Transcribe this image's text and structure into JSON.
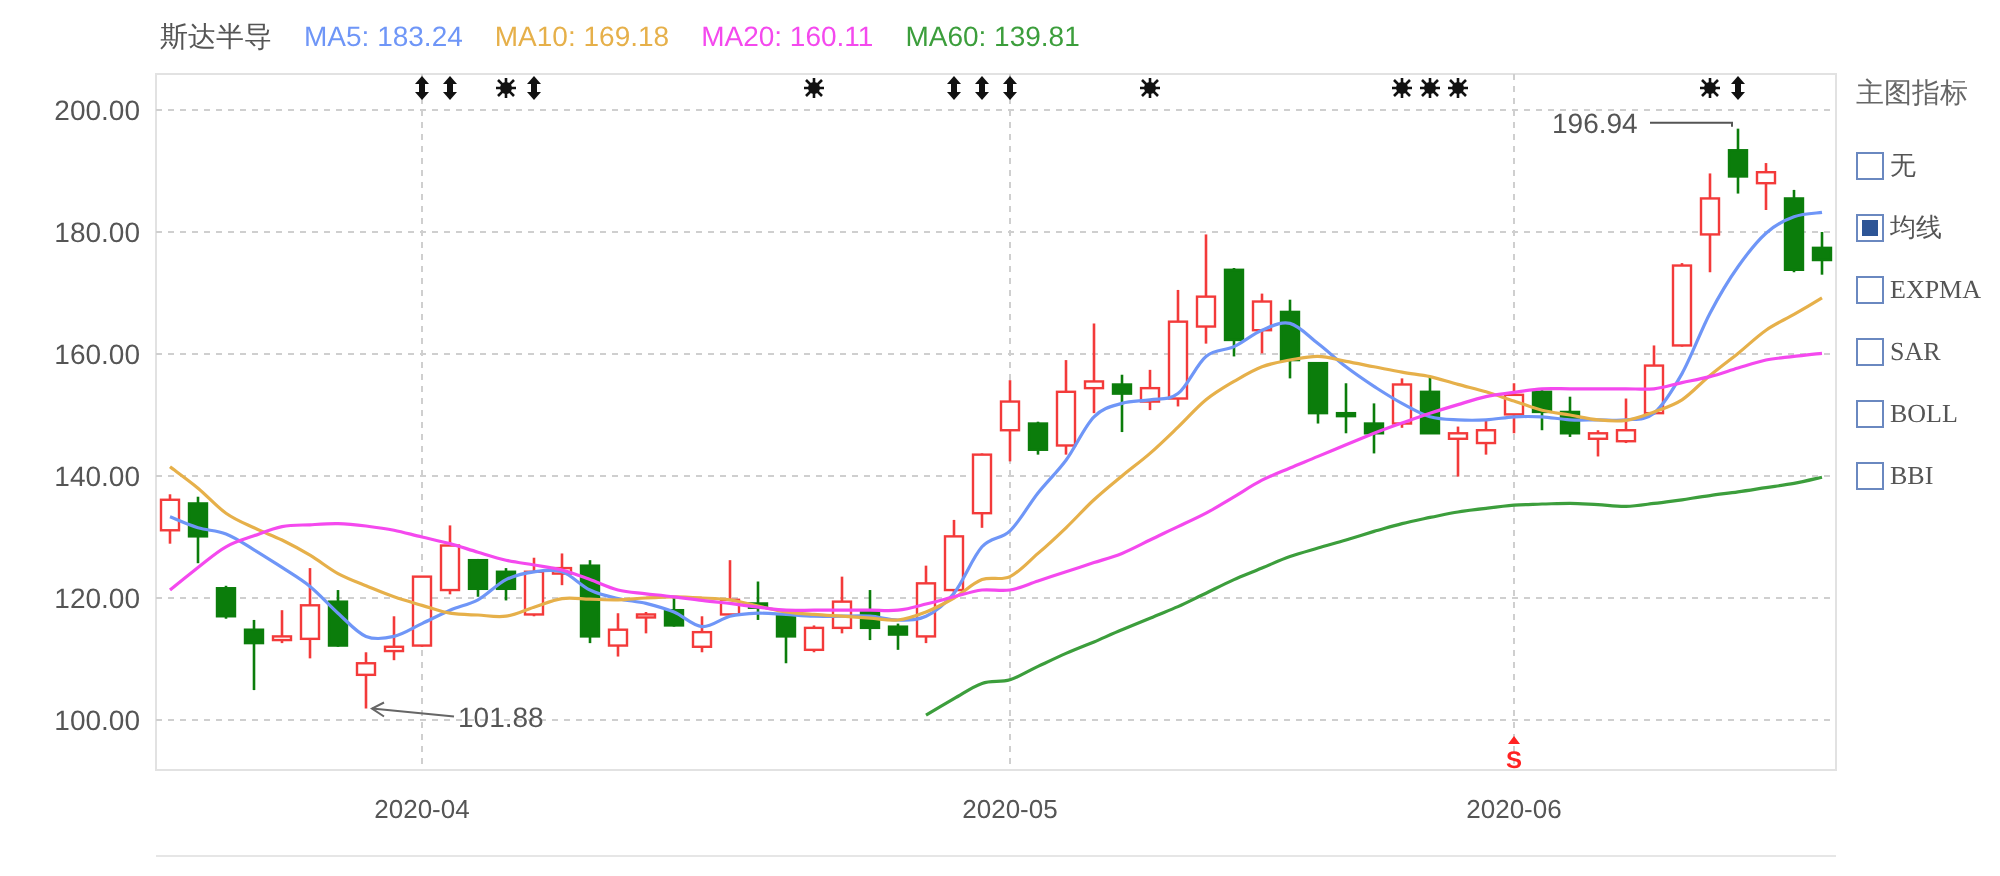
{
  "header": {
    "title": "斯达半导"
  },
  "chart": {
    "chart_data": {
      "type": "candlestick",
      "grid": true,
      "categories": [
        null,
        null,
        null,
        null,
        null,
        null,
        null,
        null,
        null,
        "2020-04",
        null,
        null,
        null,
        null,
        null,
        null,
        null,
        null,
        null,
        null,
        null,
        null,
        null,
        null,
        null,
        null,
        null,
        null,
        null,
        null,
        "2020-05",
        null,
        null,
        null,
        null,
        null,
        null,
        null,
        null,
        null,
        null,
        null,
        null,
        null,
        null,
        null,
        null,
        null,
        "2020-06",
        null,
        null,
        null,
        null,
        null,
        null,
        null,
        null,
        null,
        null,
        null
      ],
      "ylim": [
        91.8,
        205.9
      ],
      "yticks": [
        {
          "value": 100,
          "label": "100.00"
        },
        {
          "value": 120,
          "label": "120.00"
        },
        {
          "value": 140,
          "label": "140.00"
        },
        {
          "value": 160,
          "label": "160.00"
        },
        {
          "value": 180,
          "label": "180.00"
        },
        {
          "value": 200,
          "label": "200.00"
        }
      ],
      "ohlc": [
        [
          131.1,
          137.0,
          128.9,
          136.1
        ],
        [
          135.5,
          136.6,
          125.7,
          130.1
        ],
        [
          121.6,
          122.0,
          116.6,
          117.0
        ],
        [
          114.8,
          116.4,
          104.9,
          112.6
        ],
        [
          113.1,
          118.0,
          112.6,
          113.7
        ],
        [
          113.3,
          124.9,
          110.1,
          118.8
        ],
        [
          119.4,
          121.3,
          112.0,
          112.2
        ],
        [
          107.4,
          111.1,
          101.88,
          109.3
        ],
        [
          111.3,
          117.0,
          109.8,
          112.0
        ],
        [
          112.2,
          123.6,
          112.0,
          123.5
        ],
        [
          121.3,
          131.9,
          120.6,
          128.6
        ],
        [
          126.2,
          126.4,
          120.2,
          121.5
        ],
        [
          124.3,
          124.9,
          119.6,
          121.5
        ],
        [
          117.3,
          126.6,
          117.0,
          124.3
        ],
        [
          124.0,
          127.3,
          122.1,
          124.9
        ],
        [
          125.3,
          126.2,
          112.6,
          113.7
        ],
        [
          112.2,
          117.5,
          110.4,
          114.8
        ],
        [
          117.0,
          117.7,
          114.2,
          117.3
        ],
        [
          118.0,
          120.2,
          115.3,
          115.5
        ],
        [
          112.0,
          117.0,
          111.1,
          114.4
        ],
        [
          117.3,
          126.2,
          117.0,
          119.7
        ],
        [
          119.1,
          122.7,
          116.4,
          118.4
        ],
        [
          117.3,
          117.7,
          109.3,
          113.7
        ],
        [
          111.5,
          115.5,
          111.1,
          115.1
        ],
        [
          115.1,
          123.5,
          114.2,
          119.4
        ],
        [
          118.0,
          121.3,
          113.1,
          115.1
        ],
        [
          115.3,
          115.8,
          111.5,
          114.0
        ],
        [
          113.7,
          125.3,
          112.6,
          122.4
        ],
        [
          121.3,
          132.8,
          120.6,
          130.1
        ],
        [
          133.9,
          143.7,
          131.5,
          143.5
        ],
        [
          147.5,
          155.7,
          142.4,
          152.2
        ],
        [
          148.6,
          148.9,
          143.5,
          144.3
        ],
        [
          145.0,
          159.0,
          143.5,
          153.8
        ],
        [
          154.4,
          165.0,
          150.3,
          155.5
        ],
        [
          155.0,
          156.6,
          147.2,
          153.5
        ],
        [
          152.2,
          157.4,
          150.8,
          154.4
        ],
        [
          152.7,
          170.5,
          151.4,
          165.3
        ],
        [
          164.5,
          179.6,
          161.7,
          169.4
        ],
        [
          173.8,
          174.1,
          159.6,
          162.3
        ],
        [
          163.9,
          169.9,
          160.1,
          168.6
        ],
        [
          166.9,
          168.9,
          156.0,
          159.0
        ],
        [
          158.5,
          158.5,
          148.6,
          150.3
        ],
        [
          150.3,
          155.2,
          147.0,
          150.1
        ],
        [
          148.6,
          151.9,
          143.7,
          147.0
        ],
        [
          148.6,
          156.0,
          147.9,
          155.0
        ],
        [
          153.8,
          156.3,
          147.0,
          147.0
        ],
        [
          146.1,
          148.1,
          139.9,
          147.0
        ],
        [
          145.4,
          149.2,
          143.5,
          147.5
        ],
        [
          150.1,
          155.2,
          147.0,
          153.3
        ],
        [
          153.8,
          154.4,
          147.5,
          150.5
        ],
        [
          150.5,
          153.0,
          146.4,
          147.0
        ],
        [
          146.1,
          147.5,
          143.2,
          147.0
        ],
        [
          145.7,
          152.7,
          145.4,
          147.5
        ],
        [
          150.3,
          161.4,
          150.1,
          158.1
        ],
        [
          161.4,
          174.9,
          161.2,
          174.5
        ],
        [
          179.6,
          189.6,
          173.4,
          185.5
        ],
        [
          193.4,
          196.94,
          186.3,
          189.1
        ],
        [
          188.0,
          191.3,
          183.6,
          189.8
        ],
        [
          185.5,
          186.9,
          173.4,
          173.8
        ],
        [
          177.4,
          180.0,
          173.0,
          175.4
        ]
      ],
      "series": [
        {
          "name": "MA5: 183.24",
          "type": "line",
          "color": "#6f96f7",
          "values": [
            133.3,
            131.5,
            130.5,
            127.9,
            125,
            121.9,
            117.5,
            113.7,
            113.7,
            115.8,
            118.0,
            119.7,
            123.0,
            124.3,
            124.3,
            121.3,
            119.9,
            119.1,
            117.7,
            115.3,
            117.0,
            117.5,
            117.3,
            117.0,
            117.0,
            117.0,
            116.4,
            117.0,
            120.8,
            128.4,
            131,
            137.2,
            142.6,
            149.7,
            151.9,
            152.5,
            153.5,
            159.6,
            161.2,
            163.9,
            165.0,
            161.7,
            157.9,
            154.7,
            151.9,
            149.7,
            149.2,
            149.2,
            149.7,
            149.7,
            149.2,
            149.2,
            149.2,
            150.3,
            156.8,
            166.7,
            174.3,
            179.8,
            182.5,
            183.2
          ]
        },
        {
          "name": "MA10: 169.18",
          "type": "line",
          "color": "#e6b04a",
          "values": [
            141.5,
            138,
            133.9,
            131.5,
            129.5,
            127,
            124.0,
            122,
            120.2,
            118.8,
            117.5,
            117.2,
            117.0,
            118.5,
            119.9,
            119.8,
            119.7,
            120,
            120.2,
            120.0,
            119.7,
            118.7,
            117.7,
            117.3,
            117.0,
            116.7,
            116.4,
            117.7,
            120,
            123.0,
            123.5,
            127.3,
            131.5,
            136.1,
            140,
            143.7,
            148,
            152.5,
            155.5,
            157.9,
            159,
            159.6,
            158.8,
            157.9,
            157,
            156.3,
            155,
            153.8,
            152.3,
            150.8,
            150,
            149.2,
            149.1,
            150.5,
            152.5,
            156.5,
            160.1,
            163.9,
            166.5,
            169.2
          ]
        },
        {
          "name": "MA20: 160.11",
          "type": "line",
          "color": "#f449ee",
          "values": [
            121.3,
            125,
            128.4,
            130.2,
            131.7,
            132.0,
            132.2,
            131.8,
            131.1,
            130,
            128.9,
            127.5,
            126.2,
            125.4,
            124.6,
            123,
            121.3,
            120.7,
            120.2,
            119.6,
            119.1,
            118.5,
            118.0,
            118.0,
            118.0,
            118.0,
            118.0,
            119,
            120.2,
            121.3,
            121.3,
            122.8,
            124.3,
            125.8,
            127.3,
            129.5,
            131.7,
            133.9,
            136.6,
            139.3,
            141.3,
            143.2,
            145.1,
            147.0,
            148.7,
            150.3,
            151.7,
            153.0,
            153.7,
            154.3,
            154.3,
            154.3,
            154.3,
            154.3,
            155.3,
            156.3,
            157.7,
            159.0,
            159.6,
            160.1
          ]
        },
        {
          "name": "MA60: 139.81",
          "type": "line",
          "color": "#3c9e3c",
          "values": [
            null,
            null,
            null,
            null,
            null,
            null,
            null,
            null,
            null,
            null,
            null,
            null,
            null,
            null,
            null,
            null,
            null,
            null,
            null,
            null,
            null,
            null,
            null,
            null,
            null,
            null,
            null,
            100.8,
            103.5,
            106.0,
            106.6,
            108.8,
            110.9,
            112.8,
            114.8,
            116.7,
            118.6,
            120.8,
            123.0,
            124.9,
            126.8,
            128.2,
            129.5,
            130.9,
            132.2,
            133.2,
            134.1,
            134.7,
            135.2,
            135.4,
            135.5,
            135.3,
            135.0,
            135.5,
            136.1,
            136.8,
            137.4,
            138.1,
            138.8,
            139.8
          ]
        }
      ],
      "annotations": [
        "101.88",
        "196.94"
      ]
    },
    "signal": {
      "text": "S"
    },
    "event_markers": [
      {
        "kind": "blank"
      },
      {
        "kind": "blank"
      },
      {
        "kind": "blank"
      },
      {
        "kind": "blank"
      },
      {
        "kind": "blank"
      },
      {
        "kind": "blank"
      },
      {
        "kind": "blank"
      },
      {
        "kind": "blank"
      },
      {
        "kind": "blank"
      },
      {
        "kind": "arrows"
      },
      {
        "kind": "arrows"
      },
      {
        "kind": "blank"
      },
      {
        "kind": "burst"
      },
      {
        "kind": "arrows"
      },
      {
        "kind": "blank"
      },
      {
        "kind": "blank"
      },
      {
        "kind": "blank"
      },
      {
        "kind": "blank"
      },
      {
        "kind": "blank"
      },
      {
        "kind": "blank"
      },
      {
        "kind": "blank"
      },
      {
        "kind": "blank"
      },
      {
        "kind": "blank"
      },
      {
        "kind": "burst"
      },
      {
        "kind": "blank"
      },
      {
        "kind": "blank"
      },
      {
        "kind": "blank"
      },
      {
        "kind": "blank"
      },
      {
        "kind": "arrows"
      },
      {
        "kind": "arrows"
      },
      {
        "kind": "arrows"
      },
      {
        "kind": "blank"
      },
      {
        "kind": "blank"
      },
      {
        "kind": "blank"
      },
      {
        "kind": "blank"
      },
      {
        "kind": "burst"
      },
      {
        "kind": "blank"
      },
      {
        "kind": "blank"
      },
      {
        "kind": "blank"
      },
      {
        "kind": "blank"
      },
      {
        "kind": "blank"
      },
      {
        "kind": "blank"
      },
      {
        "kind": "blank"
      },
      {
        "kind": "blank"
      },
      {
        "kind": "burst"
      },
      {
        "kind": "burst"
      },
      {
        "kind": "burst"
      },
      {
        "kind": "blank"
      },
      {
        "kind": "blank"
      },
      {
        "kind": "blank"
      },
      {
        "kind": "blank"
      },
      {
        "kind": "blank"
      },
      {
        "kind": "blank"
      },
      {
        "kind": "blank"
      },
      {
        "kind": "blank"
      },
      {
        "kind": "burst"
      },
      {
        "kind": "arrows"
      },
      {
        "kind": "blank"
      },
      {
        "kind": "blank"
      },
      {
        "kind": "blank"
      }
    ]
  },
  "indicator_panel": {
    "title": "主图指标",
    "options": [
      {
        "label": "无",
        "selected": false
      },
      {
        "label": "均线",
        "selected": true
      },
      {
        "label": "EXPMA",
        "selected": false
      },
      {
        "label": "SAR",
        "selected": false
      },
      {
        "label": "BOLL",
        "selected": false
      },
      {
        "label": "BBI",
        "selected": false
      }
    ]
  }
}
